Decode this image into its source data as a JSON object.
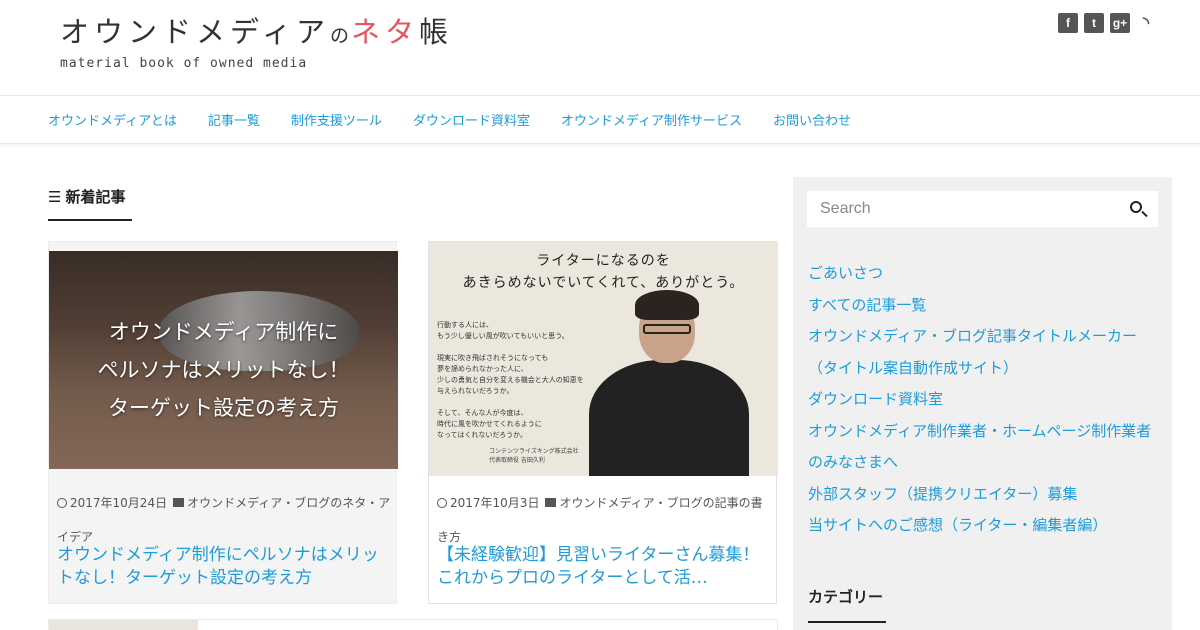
{
  "header": {
    "logo_part1": "オウンドメディア",
    "logo_part2": "の",
    "logo_part3": "ネタ",
    "logo_part4": "帳",
    "tagline": "material book of owned media",
    "social": [
      "facebook-icon",
      "twitter-icon",
      "google-plus-icon",
      "rss-icon"
    ]
  },
  "nav": {
    "items": [
      {
        "label": "オウンドメディアとは"
      },
      {
        "label": "記事一覧"
      },
      {
        "label": "制作支援ツール"
      },
      {
        "label": "ダウンロード資料室"
      },
      {
        "label": "オウンドメディア制作サービス"
      },
      {
        "label": "お問い合わせ"
      }
    ]
  },
  "main": {
    "section_title": "新着記事",
    "cards": [
      {
        "thumb_text_line1": "オウンドメディア制作に",
        "thumb_text_line2": "ペルソナはメリットなし！",
        "thumb_text_line3": "ターゲット設定の考え方",
        "date": "2017年10月24日",
        "category": "オウンドメディア・ブログのネタ・アイデア",
        "title": "オウンドメディア制作にペルソナはメリットなし！ターゲット設定の考え方"
      },
      {
        "thumb_title_line1": "ライターになるのを",
        "thumb_title_line2": "あきらめないでいてくれて、ありがとう。",
        "thumb_body": "行動する人には、\nもう少し優しい風が吹いてもいいと思う。\n\n現実に吹き飛ばされそうになっても\n夢を諦められなかった人に、\n少しの勇気と自分を変える機会と大人の知恵を\n与えられないだろうか。\n\nそして、そんな人が今度は、\n時代に風を吹かせてくれるように\nなってはくれないだろうか。",
        "thumb_sign": "コンテンツライズキング株式会社\n代表取締役 吉田久利",
        "date": "2017年10月3日",
        "category": "オウンドメディア・ブログの記事の書き方",
        "title": "【未経験歓迎】見習いライターさん募集！これからプロのライターとして活…"
      }
    ]
  },
  "sidebar": {
    "search_placeholder": "Search",
    "links": [
      {
        "label": "ごあいさつ"
      },
      {
        "label": "すべての記事一覧"
      },
      {
        "label": "オウンドメディア・ブログ記事タイトルメーカー（タイトル案自動作成サイト）"
      },
      {
        "label": "ダウンロード資料室"
      },
      {
        "label": "オウンドメディア制作業者・ホームページ制作業者のみなさまへ"
      },
      {
        "label": "外部スタッフ（提携クリエイター）募集"
      },
      {
        "label": "当サイトへのご感想（ライター・編集者編）"
      }
    ],
    "category_title": "カテゴリー"
  },
  "colors": {
    "link": "#1e9cd8",
    "logo_accent": "#e4575f",
    "sidebar_bg": "#f0f0f0"
  }
}
